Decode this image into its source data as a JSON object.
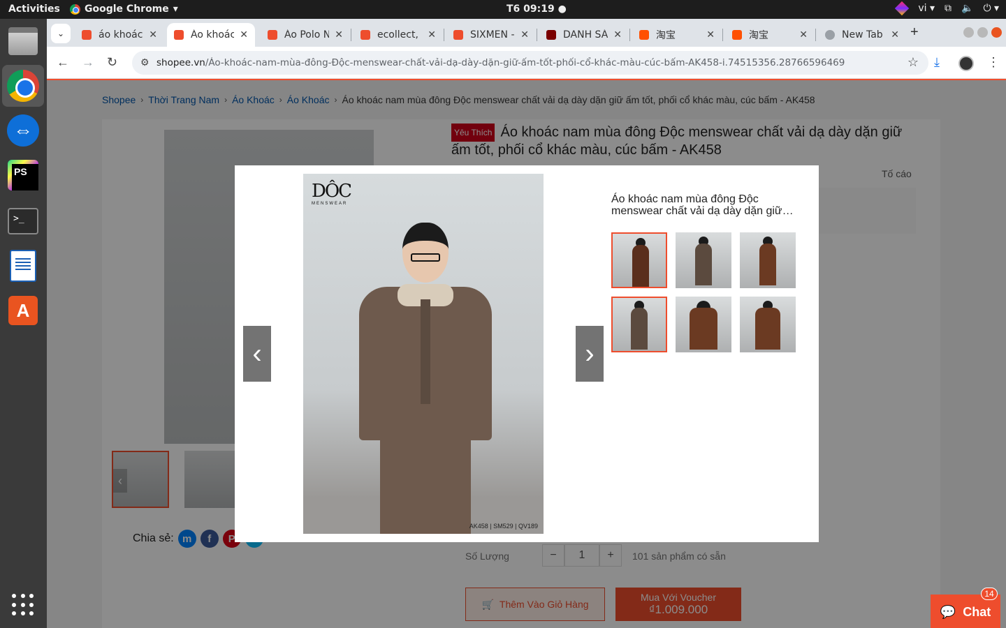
{
  "topbar": {
    "activities": "Activities",
    "app_name": "Google Chrome",
    "clock": "T6 09:19",
    "lang": "vi"
  },
  "dock": {
    "items": [
      {
        "name": "files-icon"
      },
      {
        "name": "chrome-icon"
      },
      {
        "name": "teamviewer-icon"
      },
      {
        "name": "phpstorm-icon"
      },
      {
        "name": "terminal-icon"
      },
      {
        "name": "writer-icon"
      },
      {
        "name": "app-store-icon"
      },
      {
        "name": "show-apps-icon"
      }
    ]
  },
  "tabs": [
    {
      "title": "áo khoác",
      "favicon": "shopee"
    },
    {
      "title": "Áo khoác",
      "favicon": "shopee",
      "active": true
    },
    {
      "title": "Áo Polo N",
      "favicon": "shopee"
    },
    {
      "title": "ecollect,",
      "favicon": "shopee"
    },
    {
      "title": "SIXMEN -",
      "favicon": "shopee"
    },
    {
      "title": "DANH SÁ",
      "favicon": "muji"
    },
    {
      "title": "淘宝",
      "favicon": "taobao"
    },
    {
      "title": "淘宝",
      "favicon": "taobao"
    },
    {
      "title": "New Tab",
      "favicon": "newtab"
    }
  ],
  "omnibox": {
    "host": "shopee.vn",
    "path": "/Áo-khoác-nam-mùa-đông-Độc-menswear-chất-vải-dạ-dày-dặn-giữ-ấm-tốt-phối-cổ-khác-màu-cúc-bấm-AK458-i.74515356.28766596469"
  },
  "breadcrumb": {
    "items": [
      "Shopee",
      "Thời Trang Nam",
      "Áo Khoác",
      "Áo Khoác"
    ],
    "current": "Áo khoác nam mùa đông Độc menswear chất vải dạ dày dặn giữ ấm tốt, phối cổ khác màu, cúc bấm - AK458"
  },
  "product": {
    "badge": "Yêu Thích",
    "title": "Áo khoác nam mùa đông Độc menswear chất vải dạ dày dặn giữ ấm tốt, phối cổ khác màu, cúc bấm - AK458",
    "report": "Tố cáo",
    "share_label": "Chia sẻ:",
    "quantity_label": "Số Lượng",
    "quantity_value": "1",
    "stock": "101 sản phẩm có sẵn",
    "add_to_cart": "Thêm Vào Giỏ Hàng",
    "buy_label": "Mua Với Voucher",
    "buy_price": "₫1.009.000"
  },
  "modal": {
    "title": "Áo khoác nam mùa đông Độc menswear chất vải dạ dày dặn giữ…",
    "image_code": "AK458 | SM529 | QV189",
    "brand_mark": "DÔC",
    "brand_sub": "MENSWEAR",
    "thumb_count": 6,
    "selected_thumb": 3
  },
  "chat": {
    "label": "Chat",
    "badge": "14"
  },
  "colors": {
    "shopee_orange": "#ee4d2d",
    "link_blue": "#0055aa"
  }
}
